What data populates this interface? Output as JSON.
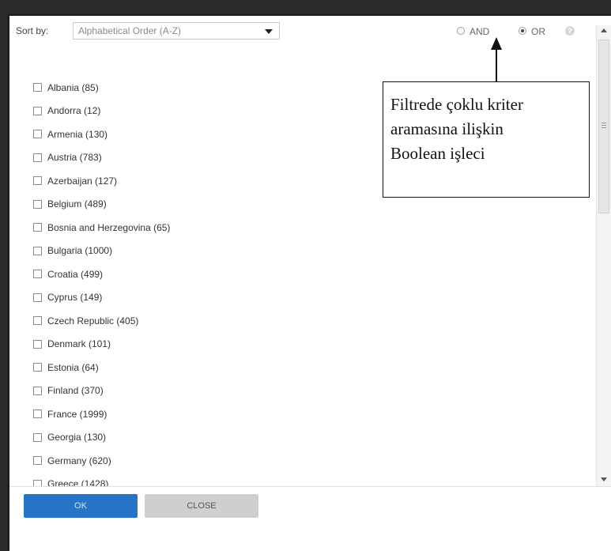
{
  "sort": {
    "label": "Sort by:",
    "selected": "Alphabetical Order (A-Z)"
  },
  "operator": {
    "and_label": "AND",
    "or_label": "OR",
    "selected": "OR",
    "help_symbol": "?"
  },
  "countries": [
    {
      "label": "Albania (85)",
      "checked": false
    },
    {
      "label": "Andorra (12)",
      "checked": false
    },
    {
      "label": "Armenia (130)",
      "checked": false
    },
    {
      "label": "Austria (783)",
      "checked": false
    },
    {
      "label": "Azerbaijan (127)",
      "checked": false
    },
    {
      "label": "Belgium (489)",
      "checked": false
    },
    {
      "label": "Bosnia and Herzegovina (65)",
      "checked": false
    },
    {
      "label": "Bulgaria (1000)",
      "checked": false
    },
    {
      "label": "Croatia (499)",
      "checked": false
    },
    {
      "label": "Cyprus (149)",
      "checked": false
    },
    {
      "label": "Czech Republic (405)",
      "checked": false
    },
    {
      "label": "Denmark (101)",
      "checked": false
    },
    {
      "label": "Estonia (64)",
      "checked": false
    },
    {
      "label": "Finland (370)",
      "checked": false
    },
    {
      "label": "France (1999)",
      "checked": false
    },
    {
      "label": "Georgia (130)",
      "checked": false
    },
    {
      "label": "Germany (620)",
      "checked": false
    },
    {
      "label": "Greece (1428)",
      "checked": false
    }
  ],
  "buttons": {
    "ok_label": "OK",
    "close_label": "CLOSE"
  },
  "annotation": {
    "lines": [
      "Filtrede çoklu kriter",
      "aramasına ilişkin",
      "Boolean işleci"
    ]
  },
  "colors": {
    "ok_button": "#2775c6",
    "close_button": "#cfcfcf"
  }
}
